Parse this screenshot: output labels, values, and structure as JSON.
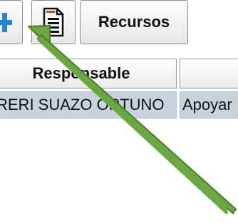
{
  "toolbar": {
    "add_icon": "plus-icon",
    "doc_icon": "document-icon",
    "recursos_label": "Recursos"
  },
  "table": {
    "headers": [
      "Responsable",
      ""
    ],
    "rows": [
      [
        "RERI SUAZO ORTUNO",
        "Apoyar"
      ]
    ]
  },
  "colors": {
    "arrow": "#6aa842",
    "plus": "#1f86d6",
    "row_highlight": "#c7d2db",
    "doc_accent": "#e0392b"
  }
}
